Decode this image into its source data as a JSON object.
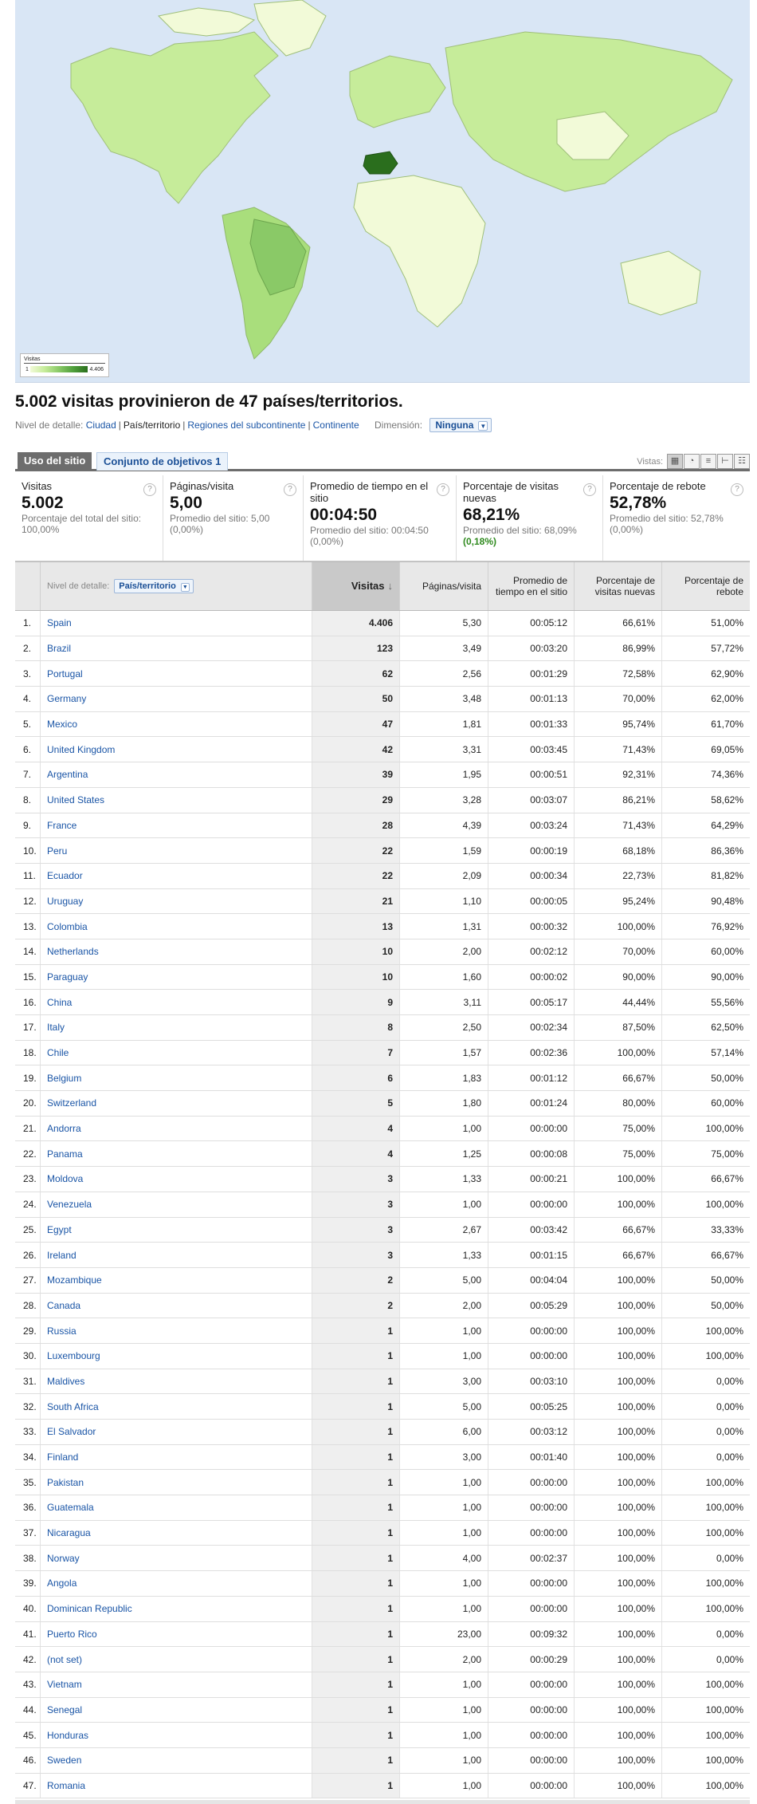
{
  "map": {
    "legend_title": "Visitas",
    "legend_min": "1",
    "legend_max": "4.406",
    "colors": {
      "ocean": "#d9e6f5",
      "low": "#f2fad8",
      "mid": "#c6ec9a",
      "high": "#2a6e1d"
    }
  },
  "summary": {
    "title": "5.002 visitas provinieron de 47 países/territorios.",
    "detail_label": "Nivel de detalle:",
    "detail_links": [
      "Ciudad",
      "País/territorio",
      "Regiones del subcontinente",
      "Continente"
    ],
    "dimension_label": "Dimensión:",
    "dimension_value": "Ninguna"
  },
  "tabs": {
    "active": "Uso del sitio",
    "inactive": "Conjunto de objetivos 1",
    "views_label": "Vistas:"
  },
  "scorecards": [
    {
      "label": "Visitas",
      "value": "5.002",
      "sub": "Porcentaje del total del sitio:",
      "sub2": "100,00%",
      "delta": ""
    },
    {
      "label": "Páginas/visita",
      "value": "5,00",
      "sub": "Promedio del sitio: 5,00",
      "sub2": "(0,00%)",
      "delta": ""
    },
    {
      "label": "Promedio de tiempo en el sitio",
      "value": "00:04:50",
      "sub": "Promedio del sitio: 00:04:50",
      "sub2": "(0,00%)",
      "delta": ""
    },
    {
      "label": "Porcentaje de visitas nuevas",
      "value": "68,21%",
      "sub": "Promedio del sitio: 68,09%",
      "sub2": "",
      "delta": "(0,18%)"
    },
    {
      "label": "Porcentaje de rebote",
      "value": "52,78%",
      "sub": "Promedio del sitio: 52,78%",
      "sub2": "(0,00%)",
      "delta": ""
    }
  ],
  "table": {
    "detail_label": "Nivel de detalle:",
    "detail_value": "País/territorio",
    "headers": {
      "visits": "Visitas",
      "pages": "Páginas/visita",
      "time": "Promedio de tiempo en el sitio",
      "new_visits": "Porcentaje de visitas nuevas",
      "bounce": "Porcentaje de rebote"
    },
    "rows": [
      [
        "1.",
        "Spain",
        "4.406",
        "5,30",
        "00:05:12",
        "66,61%",
        "51,00%"
      ],
      [
        "2.",
        "Brazil",
        "123",
        "3,49",
        "00:03:20",
        "86,99%",
        "57,72%"
      ],
      [
        "3.",
        "Portugal",
        "62",
        "2,56",
        "00:01:29",
        "72,58%",
        "62,90%"
      ],
      [
        "4.",
        "Germany",
        "50",
        "3,48",
        "00:01:13",
        "70,00%",
        "62,00%"
      ],
      [
        "5.",
        "Mexico",
        "47",
        "1,81",
        "00:01:33",
        "95,74%",
        "61,70%"
      ],
      [
        "6.",
        "United Kingdom",
        "42",
        "3,31",
        "00:03:45",
        "71,43%",
        "69,05%"
      ],
      [
        "7.",
        "Argentina",
        "39",
        "1,95",
        "00:00:51",
        "92,31%",
        "74,36%"
      ],
      [
        "8.",
        "United States",
        "29",
        "3,28",
        "00:03:07",
        "86,21%",
        "58,62%"
      ],
      [
        "9.",
        "France",
        "28",
        "4,39",
        "00:03:24",
        "71,43%",
        "64,29%"
      ],
      [
        "10.",
        "Peru",
        "22",
        "1,59",
        "00:00:19",
        "68,18%",
        "86,36%"
      ],
      [
        "11.",
        "Ecuador",
        "22",
        "2,09",
        "00:00:34",
        "22,73%",
        "81,82%"
      ],
      [
        "12.",
        "Uruguay",
        "21",
        "1,10",
        "00:00:05",
        "95,24%",
        "90,48%"
      ],
      [
        "13.",
        "Colombia",
        "13",
        "1,31",
        "00:00:32",
        "100,00%",
        "76,92%"
      ],
      [
        "14.",
        "Netherlands",
        "10",
        "2,00",
        "00:02:12",
        "70,00%",
        "60,00%"
      ],
      [
        "15.",
        "Paraguay",
        "10",
        "1,60",
        "00:00:02",
        "90,00%",
        "90,00%"
      ],
      [
        "16.",
        "China",
        "9",
        "3,11",
        "00:05:17",
        "44,44%",
        "55,56%"
      ],
      [
        "17.",
        "Italy",
        "8",
        "2,50",
        "00:02:34",
        "87,50%",
        "62,50%"
      ],
      [
        "18.",
        "Chile",
        "7",
        "1,57",
        "00:02:36",
        "100,00%",
        "57,14%"
      ],
      [
        "19.",
        "Belgium",
        "6",
        "1,83",
        "00:01:12",
        "66,67%",
        "50,00%"
      ],
      [
        "20.",
        "Switzerland",
        "5",
        "1,80",
        "00:01:24",
        "80,00%",
        "60,00%"
      ],
      [
        "21.",
        "Andorra",
        "4",
        "1,00",
        "00:00:00",
        "75,00%",
        "100,00%"
      ],
      [
        "22.",
        "Panama",
        "4",
        "1,25",
        "00:00:08",
        "75,00%",
        "75,00%"
      ],
      [
        "23.",
        "Moldova",
        "3",
        "1,33",
        "00:00:21",
        "100,00%",
        "66,67%"
      ],
      [
        "24.",
        "Venezuela",
        "3",
        "1,00",
        "00:00:00",
        "100,00%",
        "100,00%"
      ],
      [
        "25.",
        "Egypt",
        "3",
        "2,67",
        "00:03:42",
        "66,67%",
        "33,33%"
      ],
      [
        "26.",
        "Ireland",
        "3",
        "1,33",
        "00:01:15",
        "66,67%",
        "66,67%"
      ],
      [
        "27.",
        "Mozambique",
        "2",
        "5,00",
        "00:04:04",
        "100,00%",
        "50,00%"
      ],
      [
        "28.",
        "Canada",
        "2",
        "2,00",
        "00:05:29",
        "100,00%",
        "50,00%"
      ],
      [
        "29.",
        "Russia",
        "1",
        "1,00",
        "00:00:00",
        "100,00%",
        "100,00%"
      ],
      [
        "30.",
        "Luxembourg",
        "1",
        "1,00",
        "00:00:00",
        "100,00%",
        "100,00%"
      ],
      [
        "31.",
        "Maldives",
        "1",
        "3,00",
        "00:03:10",
        "100,00%",
        "0,00%"
      ],
      [
        "32.",
        "South Africa",
        "1",
        "5,00",
        "00:05:25",
        "100,00%",
        "0,00%"
      ],
      [
        "33.",
        "El Salvador",
        "1",
        "6,00",
        "00:03:12",
        "100,00%",
        "0,00%"
      ],
      [
        "34.",
        "Finland",
        "1",
        "3,00",
        "00:01:40",
        "100,00%",
        "0,00%"
      ],
      [
        "35.",
        "Pakistan",
        "1",
        "1,00",
        "00:00:00",
        "100,00%",
        "100,00%"
      ],
      [
        "36.",
        "Guatemala",
        "1",
        "1,00",
        "00:00:00",
        "100,00%",
        "100,00%"
      ],
      [
        "37.",
        "Nicaragua",
        "1",
        "1,00",
        "00:00:00",
        "100,00%",
        "100,00%"
      ],
      [
        "38.",
        "Norway",
        "1",
        "4,00",
        "00:02:37",
        "100,00%",
        "0,00%"
      ],
      [
        "39.",
        "Angola",
        "1",
        "1,00",
        "00:00:00",
        "100,00%",
        "100,00%"
      ],
      [
        "40.",
        "Dominican Republic",
        "1",
        "1,00",
        "00:00:00",
        "100,00%",
        "100,00%"
      ],
      [
        "41.",
        "Puerto Rico",
        "1",
        "23,00",
        "00:09:32",
        "100,00%",
        "0,00%"
      ],
      [
        "42.",
        "(not set)",
        "1",
        "2,00",
        "00:00:29",
        "100,00%",
        "0,00%"
      ],
      [
        "43.",
        "Vietnam",
        "1",
        "1,00",
        "00:00:00",
        "100,00%",
        "100,00%"
      ],
      [
        "44.",
        "Senegal",
        "1",
        "1,00",
        "00:00:00",
        "100,00%",
        "100,00%"
      ],
      [
        "45.",
        "Honduras",
        "1",
        "1,00",
        "00:00:00",
        "100,00%",
        "100,00%"
      ],
      [
        "46.",
        "Sweden",
        "1",
        "1,00",
        "00:00:00",
        "100,00%",
        "100,00%"
      ],
      [
        "47.",
        "Romania",
        "1",
        "1,00",
        "00:00:00",
        "100,00%",
        "100,00%"
      ]
    ]
  }
}
